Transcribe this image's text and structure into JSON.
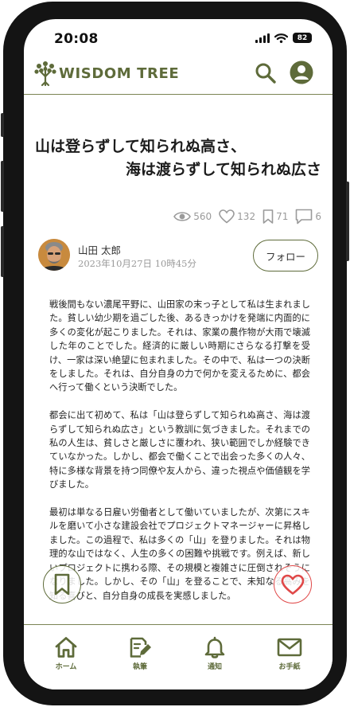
{
  "status": {
    "time": "20:08",
    "battery": "82"
  },
  "header": {
    "brand": "WISDOM TREE"
  },
  "article": {
    "title_line1": "山は登らずして知られぬ高さ、",
    "title_line2": "海は渡らずして知られぬ広さ",
    "stats": {
      "views": "560",
      "likes": "132",
      "bookmarks": "71",
      "comments": "6"
    },
    "author": {
      "name": "山田 太郎",
      "date": "2023年10月27日 10時45分"
    },
    "follow_label": "フォロー",
    "paragraphs": [
      "戦後間もない濃尾平野に、山田家の末っ子として私は生まれました。貧しい幼少期を過ごした後、あるきっかけを発端に内面的に多くの変化が起こりました。それは、家業の農作物が大雨で壊滅した年のことでした。経済的に厳しい時期にさらなる打撃を受け、一家は深い絶望に包まれました。その中で、私は一つの決断をしました。それは、自分自身の力で何かを変えるために、都会へ行って働くという決断でした。",
      "都会に出て初めて、私は「山は登らずして知られぬ高さ、海は渡らずして知られぬ広さ」という教訓に気づきました。それまでの私の人生は、貧しさと厳しさに覆われ、狭い範囲でしか経験できていなかった。しかし、都会で働くことで出会った多くの人々、特に多様な背景を持つ同僚や友人から、違った視点や価値観を学びました。",
      "最初は単なる日雇い労働者として働いていましたが、次第にスキルを磨いて小さな建設会社でプロジェクトマネージャーに昇格しました。この過程で、私は多くの「山」を登りました。それは物理的な山ではなく、人生の多くの困難や挑戦です。例えば、新しいプロジェクトに携わる際、その規模と複雑さに圧倒されそうになりました。しかし、その「山」を登ることで、未知なる高みを知る喜びと、自分自身の成長を実感しました。"
    ]
  },
  "nav": {
    "home": "ホーム",
    "write": "執筆",
    "notify": "通知",
    "mail": "お手紙"
  },
  "colors": {
    "accent": "#5e6b3a",
    "like": "#e04848",
    "muted": "#9a9a9a"
  },
  "icons": [
    "tree-logo-icon",
    "search-icon",
    "user-icon",
    "eye-icon",
    "heart-icon",
    "bookmark-icon",
    "comment-icon",
    "home-icon",
    "edit-icon",
    "bell-icon",
    "mail-icon"
  ]
}
